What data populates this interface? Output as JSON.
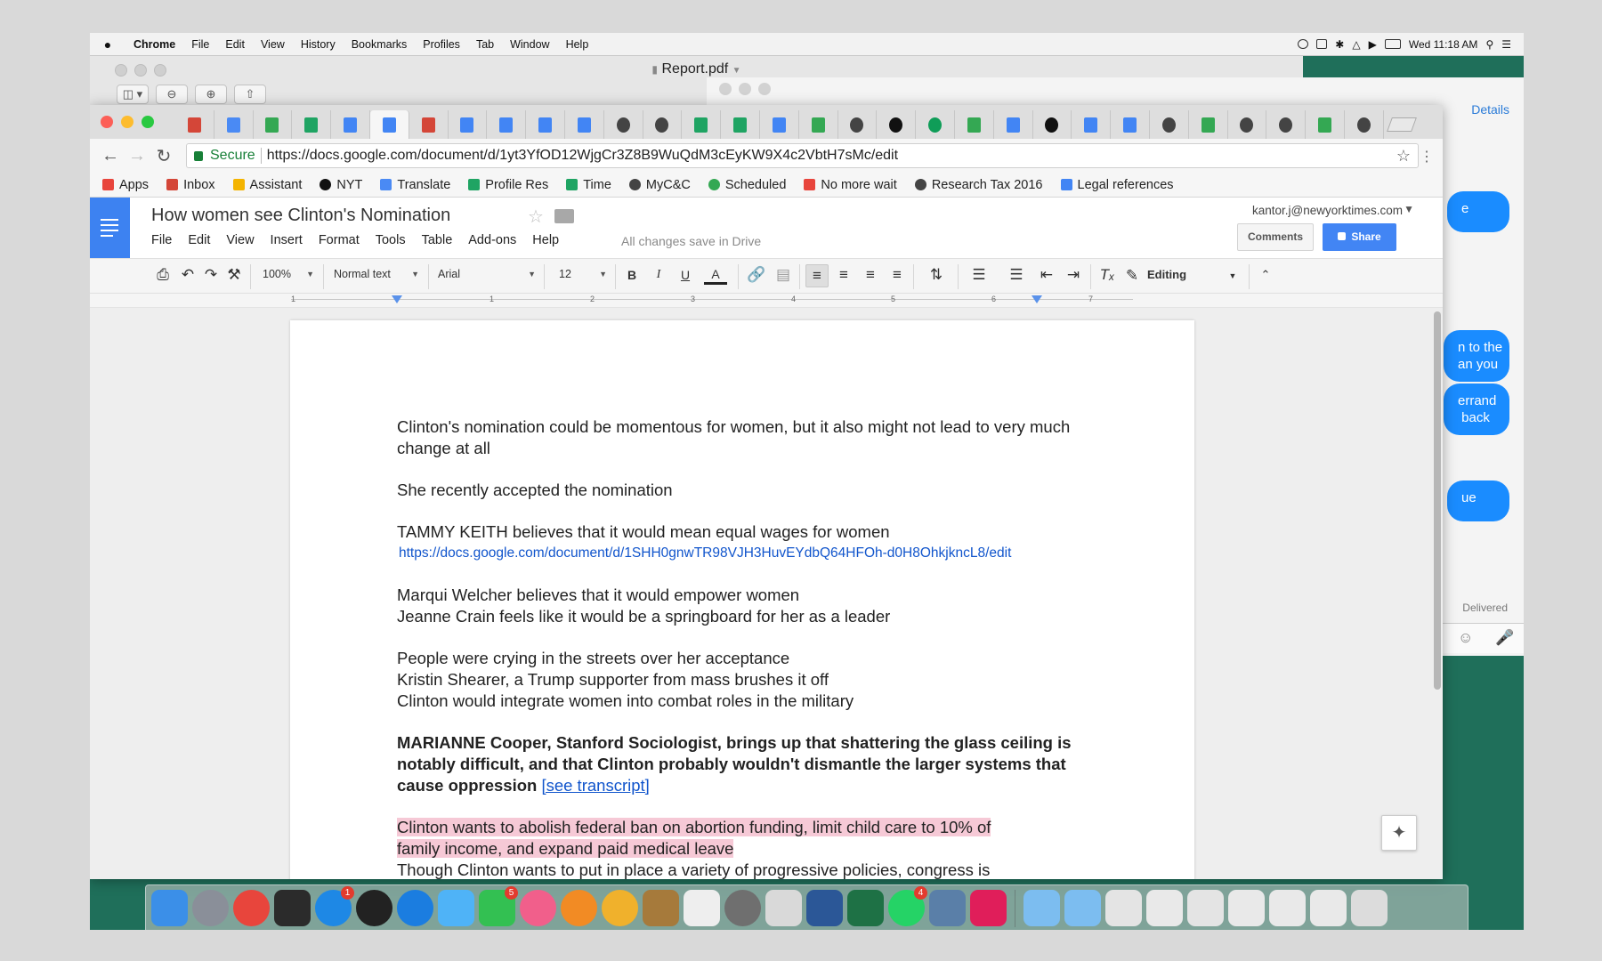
{
  "menubar": {
    "apple_icon": "apple-logo-icon",
    "app": "Chrome",
    "items": [
      "File",
      "Edit",
      "View",
      "History",
      "Bookmarks",
      "Profiles",
      "Tab",
      "Window",
      "Help"
    ],
    "clock": "Wed 11:18 AM"
  },
  "preview_window": {
    "title": "Report.pdf"
  },
  "messages_window": {
    "details": "Details",
    "bubbles": [
      "e",
      "n to the\nan you",
      "errand\n back",
      "ue"
    ],
    "delivered": "Delivered"
  },
  "chrome": {
    "url_secure_label": "Secure",
    "url": "https://docs.google.com/document/d/1yt3YfOD12WjgCr3Z8B9WuQdM3cEyKW9X4c2VbtH7sMc/edit",
    "tab_icons": [
      {
        "icon": "gmail-icon",
        "color": "#d44638"
      },
      {
        "icon": "translate-icon",
        "color": "#4a8af4"
      },
      {
        "icon": "drive-icon",
        "color": "#34a853"
      },
      {
        "icon": "sheets-icon",
        "color": "#1fa463"
      },
      {
        "icon": "docs-icon",
        "color": "#4285f4"
      },
      {
        "icon": "docs-icon",
        "color": "#4285f4"
      },
      {
        "icon": "gmail-icon",
        "color": "#d44638"
      },
      {
        "icon": "docs-icon",
        "color": "#4285f4"
      },
      {
        "icon": "docs-icon",
        "color": "#4285f4"
      },
      {
        "icon": "docs-icon",
        "color": "#4285f4"
      },
      {
        "icon": "docs-icon",
        "color": "#4285f4"
      },
      {
        "icon": "globe-icon",
        "color": "#444444"
      },
      {
        "icon": "globe-icon",
        "color": "#444444"
      },
      {
        "icon": "sheets-icon",
        "color": "#1fa463"
      },
      {
        "icon": "sheets-icon",
        "color": "#1fa463"
      },
      {
        "icon": "calendar-icon",
        "color": "#4285f4"
      },
      {
        "icon": "drive-icon",
        "color": "#34a853"
      },
      {
        "icon": "globe-icon",
        "color": "#444444"
      },
      {
        "icon": "nyt-icon",
        "color": "#111111"
      },
      {
        "icon": "hangouts-icon",
        "color": "#0f9d58"
      },
      {
        "icon": "drive-icon",
        "color": "#34a853"
      },
      {
        "icon": "docs-icon",
        "color": "#4285f4"
      },
      {
        "icon": "nyt-icon",
        "color": "#111111"
      },
      {
        "icon": "docs-icon",
        "color": "#4285f4"
      },
      {
        "icon": "docs-icon",
        "color": "#4285f4"
      },
      {
        "icon": "globe-icon",
        "color": "#444444"
      },
      {
        "icon": "drive-icon",
        "color": "#34a853"
      },
      {
        "icon": "globe-icon",
        "color": "#444444"
      },
      {
        "icon": "globe-icon",
        "color": "#444444"
      },
      {
        "icon": "drive-icon",
        "color": "#34a853"
      },
      {
        "icon": "globe-icon",
        "color": "#444444"
      }
    ],
    "active_tab_index": 5,
    "bookmarks": [
      {
        "label": "Apps",
        "icon": "apps-grid-icon",
        "color": "#e8453c"
      },
      {
        "label": "Inbox",
        "icon": "gmail-icon",
        "color": "#d44638"
      },
      {
        "label": "Assistant",
        "icon": "assistant-icon",
        "color": "#f4b400"
      },
      {
        "label": "NYT",
        "icon": "nyt-icon",
        "color": "#111111"
      },
      {
        "label": "Translate",
        "icon": "translate-icon",
        "color": "#4a8af4"
      },
      {
        "label": "Profile Res",
        "icon": "sheets-icon",
        "color": "#1fa463"
      },
      {
        "label": "Time",
        "icon": "sheets-icon",
        "color": "#1fa463"
      },
      {
        "label": "MyC&C",
        "icon": "globe-icon",
        "color": "#444444"
      },
      {
        "label": "Scheduled",
        "icon": "clock-icon",
        "color": "#34a853"
      },
      {
        "label": "No more wait",
        "icon": "calendar-icon",
        "color": "#e8453c"
      },
      {
        "label": "Research Tax 2016",
        "icon": "globe-icon",
        "color": "#444444"
      },
      {
        "label": "Legal references",
        "icon": "docs-icon",
        "color": "#4285f4"
      }
    ]
  },
  "docs": {
    "title": "How women see Clinton's Nomination",
    "menu": [
      "File",
      "Edit",
      "View",
      "Insert",
      "Format",
      "Tools",
      "Table",
      "Add-ons",
      "Help"
    ],
    "save_status": "All changes save in Drive",
    "account": "kantor.j@newyorktimes.com",
    "comments_label": "Comments",
    "share_label": "Share",
    "toolbar": {
      "zoom": "100%",
      "style": "Normal text",
      "font": "Arial",
      "size": "12",
      "bold": "B",
      "italic": "I",
      "underline": "U",
      "text_color": "A",
      "editing_mode": "Editing"
    },
    "ruler_numbers": [
      "1",
      "1",
      "2",
      "3",
      "4",
      "5",
      "6",
      "7"
    ],
    "body": {
      "p1": "Clinton's nomination could be momentous for women, but it also might not lead to very much change at all",
      "p2": "She recently accepted the nomination",
      "p3": "TAMMY KEITH believes that it would mean equal wages for women",
      "p3_link": "https://docs.google.com/document/d/1SHH0gnwTR98VJH3HuvEYdbQ64HFOh-d0H8OhkjkncL8/edit",
      "p4a": "Marqui Welcher believes that it would empower women",
      "p4b": "Jeanne Crain feels like it would be a springboard for her as a leader",
      "p5a": "People were crying in the streets over her acceptance",
      "p5b": "Kristin Shearer, a Trump supporter from mass brushes it off",
      "p5c": "Clinton would integrate women into combat roles in the military",
      "p6": "MARIANNE Cooper, Stanford Sociologist, brings up that shattering the glass ceiling is notably difficult, and that Clinton probably wouldn't dismantle the larger systems that cause oppression",
      "p6_link": "[see transcript]",
      "p7a": "Clinton wants to abolish federal ban on abortion funding, limit child care to 10% of",
      "p7b": "family income, and expand paid medical leave",
      "p8": "Though Clinton wants to put in place a variety of progressive policies, congress is"
    },
    "highlight_color": "#f6c9d6"
  },
  "dock": {
    "apps": [
      {
        "icon": "finder-icon",
        "color": "#3b8fe8",
        "badge": ""
      },
      {
        "icon": "launchpad-icon",
        "color": "#8a8f99",
        "badge": ""
      },
      {
        "icon": "chrome-icon",
        "color": "#e8453c",
        "badge": ""
      },
      {
        "icon": "mission-control-icon",
        "color": "#2b2b2b",
        "badge": ""
      },
      {
        "icon": "app-store-icon",
        "color": "#1e88e5",
        "badge": "1"
      },
      {
        "icon": "dashboard-icon",
        "color": "#222222",
        "badge": ""
      },
      {
        "icon": "safari-icon",
        "color": "#1b7de0",
        "badge": ""
      },
      {
        "icon": "messages-icon",
        "color": "#4fb3f7",
        "badge": ""
      },
      {
        "icon": "facetime-icon",
        "color": "#33c052",
        "badge": "5"
      },
      {
        "icon": "itunes-icon",
        "color": "#f15f8b",
        "badge": ""
      },
      {
        "icon": "ibooks-icon",
        "color": "#f28b24",
        "badge": ""
      },
      {
        "icon": "photos-icon",
        "color": "#f0b12c",
        "badge": ""
      },
      {
        "icon": "notebook-icon",
        "color": "#a67a3b",
        "badge": ""
      },
      {
        "icon": "textedit-icon",
        "color": "#eeeeee",
        "badge": ""
      },
      {
        "icon": "system-preferences-icon",
        "color": "#6f6f6f",
        "badge": ""
      },
      {
        "icon": "preview-icon",
        "color": "#d9d9d9",
        "badge": ""
      },
      {
        "icon": "word-icon",
        "color": "#2b5797",
        "badge": ""
      },
      {
        "icon": "excel-icon",
        "color": "#1e7145",
        "badge": ""
      },
      {
        "icon": "whatsapp-icon",
        "color": "#25d366",
        "badge": "4"
      },
      {
        "icon": "utility-icon",
        "color": "#5a7fa8",
        "badge": ""
      },
      {
        "icon": "slack-icon",
        "color": "#e01e5a",
        "badge": ""
      },
      {
        "icon": "folder-icon",
        "color": "#7cbdf0",
        "badge": ""
      },
      {
        "icon": "folder-icon",
        "color": "#7cbdf0",
        "badge": ""
      },
      {
        "icon": "document-stack-icon",
        "color": "#e4e4e4",
        "badge": ""
      },
      {
        "icon": "window-thumbnail-icon",
        "color": "#e9e9e9",
        "badge": ""
      },
      {
        "icon": "document-stack-icon",
        "color": "#e4e4e4",
        "badge": ""
      },
      {
        "icon": "window-thumbnail-icon",
        "color": "#e9e9e9",
        "badge": ""
      },
      {
        "icon": "window-thumbnail-icon",
        "color": "#e9e9e9",
        "badge": ""
      },
      {
        "icon": "window-thumbnail-icon",
        "color": "#e9e9e9",
        "badge": ""
      },
      {
        "icon": "trash-icon",
        "color": "#dcdcdc",
        "badge": ""
      }
    ]
  }
}
